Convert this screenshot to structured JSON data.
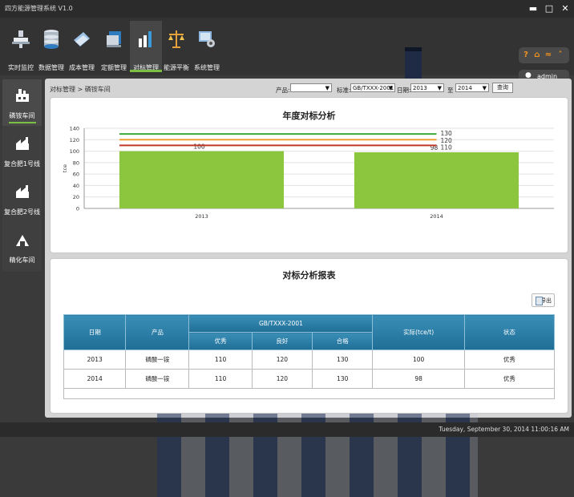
{
  "window": {
    "title": "四方能源管理系统 V1.0"
  },
  "toolbar": {
    "items": [
      {
        "label": "实时监控",
        "icon": "monitor-icon"
      },
      {
        "label": "数据管理",
        "icon": "database-icon"
      },
      {
        "label": "成本管理",
        "icon": "cost-icon"
      },
      {
        "label": "定额管理",
        "icon": "quota-icon"
      },
      {
        "label": "对标管理",
        "icon": "benchmark-icon"
      },
      {
        "label": "能源平衡",
        "icon": "balance-icon"
      },
      {
        "label": "系统管理",
        "icon": "settings-icon"
      }
    ],
    "active_index": 4
  },
  "user": {
    "name": "admin"
  },
  "sidebar": {
    "items": [
      {
        "label": "磷铵车间"
      },
      {
        "label": "复合肥1号线"
      },
      {
        "label": "复合肥2号线"
      },
      {
        "label": "精化车间"
      }
    ],
    "active_index": 0
  },
  "filters": {
    "breadcrumb": "对标管理 > 磷铵车间",
    "product_label": "产品:",
    "product_value": "",
    "standard_label": "标准:",
    "standard_value": "GB/TXXX-2001",
    "date_label": "日期:",
    "date_from": "2013",
    "to_label": "至",
    "date_to": "2014",
    "query_label": "查询"
  },
  "chart_panel": {
    "title": "年度对标分析"
  },
  "chart_data": {
    "type": "bar",
    "categories": [
      "2013",
      "2014"
    ],
    "values": [
      100,
      98
    ],
    "ylabel": "tce",
    "ylim": [
      0,
      140
    ],
    "yticks": [
      0,
      20,
      40,
      60,
      80,
      100,
      120,
      140
    ],
    "bar_color": "#8cc63f",
    "reference_lines": [
      {
        "value": 130,
        "color": "#3caa3c"
      },
      {
        "value": 120,
        "color": "#f0a030"
      },
      {
        "value": 110,
        "color": "#c0392b"
      }
    ],
    "grid": true
  },
  "table_panel": {
    "title": "对标分析报表",
    "export_label": "导出",
    "headers": {
      "date": "日期",
      "product": "产品",
      "standard": "GB/TXXX-2001",
      "excellent": "优秀",
      "good": "良好",
      "pass": "合格",
      "actual": "实际(tce/t)",
      "status": "状态"
    },
    "rows": [
      {
        "date": "2013",
        "product": "磷酸一铵",
        "excellent": "110",
        "good": "120",
        "pass": "130",
        "actual": "100",
        "status": "优秀"
      },
      {
        "date": "2014",
        "product": "磷酸一铵",
        "excellent": "110",
        "good": "120",
        "pass": "130",
        "actual": "98",
        "status": "优秀"
      }
    ]
  },
  "statusbar": {
    "datetime": "Tuesday, September 30, 2014 11:00:16 AM"
  }
}
